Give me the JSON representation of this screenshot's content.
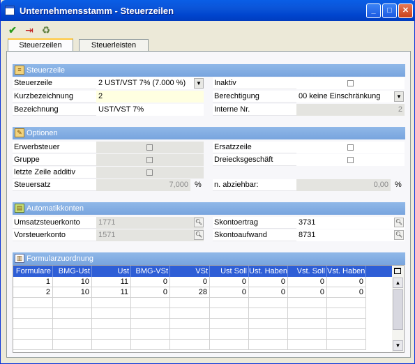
{
  "window": {
    "title": "Unternehmensstamm - Steuerzeilen"
  },
  "tabs": [
    {
      "label": "Steuerzeilen"
    },
    {
      "label": "Steuerleisten"
    }
  ],
  "sections": {
    "steuerzeile": "Steuerzeile",
    "optionen": "Optionen",
    "automatikkonten": "Automatikkonten",
    "formularzuordnung": "Formularzuordnung"
  },
  "steuerzeile": {
    "steuerzeile_label": "Steuerzeile",
    "steuerzeile_value": "2   UST/VST 7% (7.000 %)",
    "kurzbezeichnung_label": "Kurzbezeichnung",
    "kurzbezeichnung_value": "2",
    "bezeichnung_label": "Bezeichnung",
    "bezeichnung_value": "UST/VST 7%",
    "inaktiv_label": "Inaktiv",
    "inaktiv_checked": false,
    "berechtigung_label": "Berechtigung",
    "berechtigung_value": "00 keine Einschränkung",
    "interne_nr_label": "Interne Nr.",
    "interne_nr_value": "2"
  },
  "optionen": {
    "erwerbsteuer_label": "Erwerbsteuer",
    "gruppe_label": "Gruppe",
    "letzte_zeile_label": "letzte Zeile additiv",
    "steuersatz_label": "Steuersatz",
    "steuersatz_value": "7,000",
    "steuersatz_unit": "%",
    "ersatzzeile_label": "Ersatzzeile",
    "dreiecksgeschaeft_label": "Dreiecksgeschäft",
    "abziehbar_label": "n. abziehbar:",
    "abziehbar_value": "0,00",
    "abziehbar_unit": "%"
  },
  "automatikkonten": {
    "umsatzsteuerkonto_label": "Umsatzsteuerkonto",
    "umsatzsteuerkonto_value": "1771",
    "vorsteuerkonto_label": "Vorsteuerkonto",
    "vorsteuerkonto_value": "1571",
    "skontoertrag_label": "Skontoertrag",
    "skontoertrag_value": "3731",
    "skontoaufwand_label": "Skontoaufwand",
    "skontoaufwand_value": "8731"
  },
  "grid": {
    "columns": [
      "Formulare",
      "BMG-Ust",
      "Ust",
      "BMG-VSt",
      "VSt",
      "Ust Soll",
      "Ust. Haben",
      "Vst. Soll",
      "Vst. Haben"
    ],
    "rows": [
      [
        "1",
        "10",
        "11",
        "0",
        "0",
        "0",
        "0",
        "0",
        "0"
      ],
      [
        "2",
        "10",
        "11",
        "0",
        "28",
        "0",
        "0",
        "0",
        "0"
      ]
    ]
  }
}
